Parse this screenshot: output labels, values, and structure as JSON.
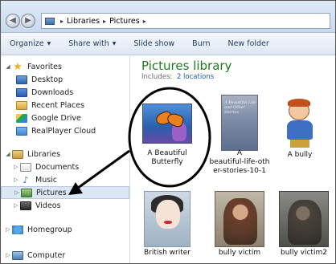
{
  "address_bar": {
    "breadcrumbs": [
      "Libraries",
      "Pictures"
    ]
  },
  "toolbar": {
    "organize_label": "Organize",
    "share_with_label": "Share with",
    "slide_show_label": "Slide show",
    "burn_label": "Burn",
    "new_folder_label": "New folder"
  },
  "navigation": {
    "favorites": {
      "label": "Favorites",
      "items": [
        {
          "label": "Desktop",
          "icon": "desktop-icon"
        },
        {
          "label": "Downloads",
          "icon": "downloads-icon"
        },
        {
          "label": "Recent Places",
          "icon": "recent-places-icon"
        },
        {
          "label": "Google Drive",
          "icon": "google-drive-icon"
        },
        {
          "label": "RealPlayer Cloud",
          "icon": "realplayer-icon"
        }
      ]
    },
    "libraries": {
      "label": "Libraries",
      "items": [
        {
          "label": "Documents",
          "icon": "documents-icon"
        },
        {
          "label": "Music",
          "icon": "music-icon"
        },
        {
          "label": "Pictures",
          "icon": "pictures-icon",
          "selected": true
        },
        {
          "label": "Videos",
          "icon": "videos-icon"
        }
      ]
    },
    "homegroup": {
      "label": "Homegroup"
    },
    "computer": {
      "label": "Computer"
    }
  },
  "content": {
    "title": "Pictures library",
    "includes_label": "Includes:",
    "includes_link": "2 locations",
    "files": [
      {
        "name": "A Beautiful Butterfly",
        "line1": "A Beautiful",
        "line2": "Butterfly",
        "icon": "butterfly-thumbnail"
      },
      {
        "name": "A beautiful-life-other-stories-10-1",
        "line1": "A",
        "line2": "beautiful-life-oth",
        "line3": "er-stories-10-1",
        "icon": "book-cover-thumbnail",
        "cover_text": "A Beautiful Life and Other Stories"
      },
      {
        "name": "A bully",
        "line1": "A bully",
        "icon": "cartoon-bully-thumbnail"
      },
      {
        "name": "British writer",
        "line1": "British writer",
        "icon": "portrait-thumbnail"
      },
      {
        "name": "bully victim",
        "line1": "bully victim",
        "icon": "sad-person-thumbnail"
      },
      {
        "name": "bully victim2",
        "line1": "bully victim2",
        "icon": "sad-person-thumbnail"
      }
    ]
  },
  "colors": {
    "library_title": "#1e7a1e",
    "link": "#1d5fb8",
    "selected_row": "#dde8f6"
  }
}
